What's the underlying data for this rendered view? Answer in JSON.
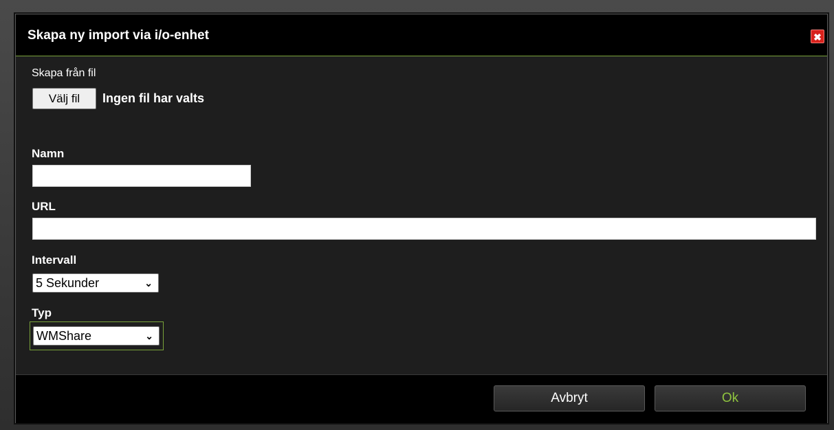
{
  "dialog": {
    "title": "Skapa ny import via i/o-enhet",
    "close_icon": "close-icon",
    "close_glyph": "✖"
  },
  "file": {
    "label": "Skapa från fil",
    "button_label": "Välj fil",
    "status": "Ingen fil har valts"
  },
  "form": {
    "name_label": "Namn",
    "name_value": "",
    "url_label": "URL",
    "url_value": "",
    "interval_label": "Intervall",
    "interval_value": "5 Sekunder",
    "type_label": "Typ",
    "type_value": "WMShare"
  },
  "footer": {
    "cancel_label": "Avbryt",
    "ok_label": "Ok"
  },
  "colors": {
    "accent": "#7aa33a",
    "ok_text": "#8fc43f",
    "close_red": "#d8221c"
  }
}
